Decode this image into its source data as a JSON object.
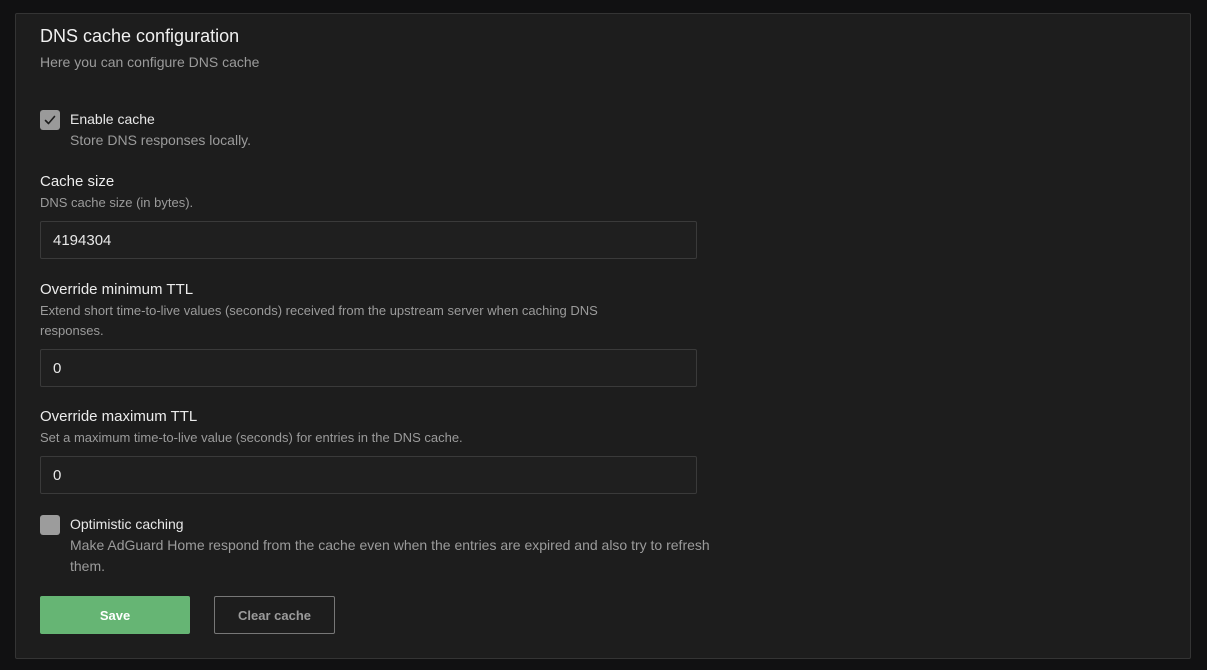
{
  "card": {
    "title": "DNS cache configuration",
    "subtitle": "Here you can configure DNS cache"
  },
  "enable_cache": {
    "checked": true,
    "label": "Enable cache",
    "description": "Store DNS responses locally."
  },
  "cache_size": {
    "label": "Cache size",
    "description": "DNS cache size (in bytes).",
    "value": "4194304"
  },
  "min_ttl": {
    "label": "Override minimum TTL",
    "description": "Extend short time-to-live values (seconds) received from the upstream server when caching DNS responses.",
    "value": "0"
  },
  "max_ttl": {
    "label": "Override maximum TTL",
    "description": "Set a maximum time-to-live value (seconds) for entries in the DNS cache.",
    "value": "0"
  },
  "optimistic": {
    "checked": false,
    "label": "Optimistic caching",
    "description": "Make AdGuard Home respond from the cache even when the entries are expired and also try to refresh them."
  },
  "buttons": {
    "save": "Save",
    "clear_cache": "Clear cache"
  },
  "colors": {
    "accent": "#66b574",
    "background": "#1d1d1d"
  },
  "icons": {
    "checkmark": "check-icon"
  }
}
